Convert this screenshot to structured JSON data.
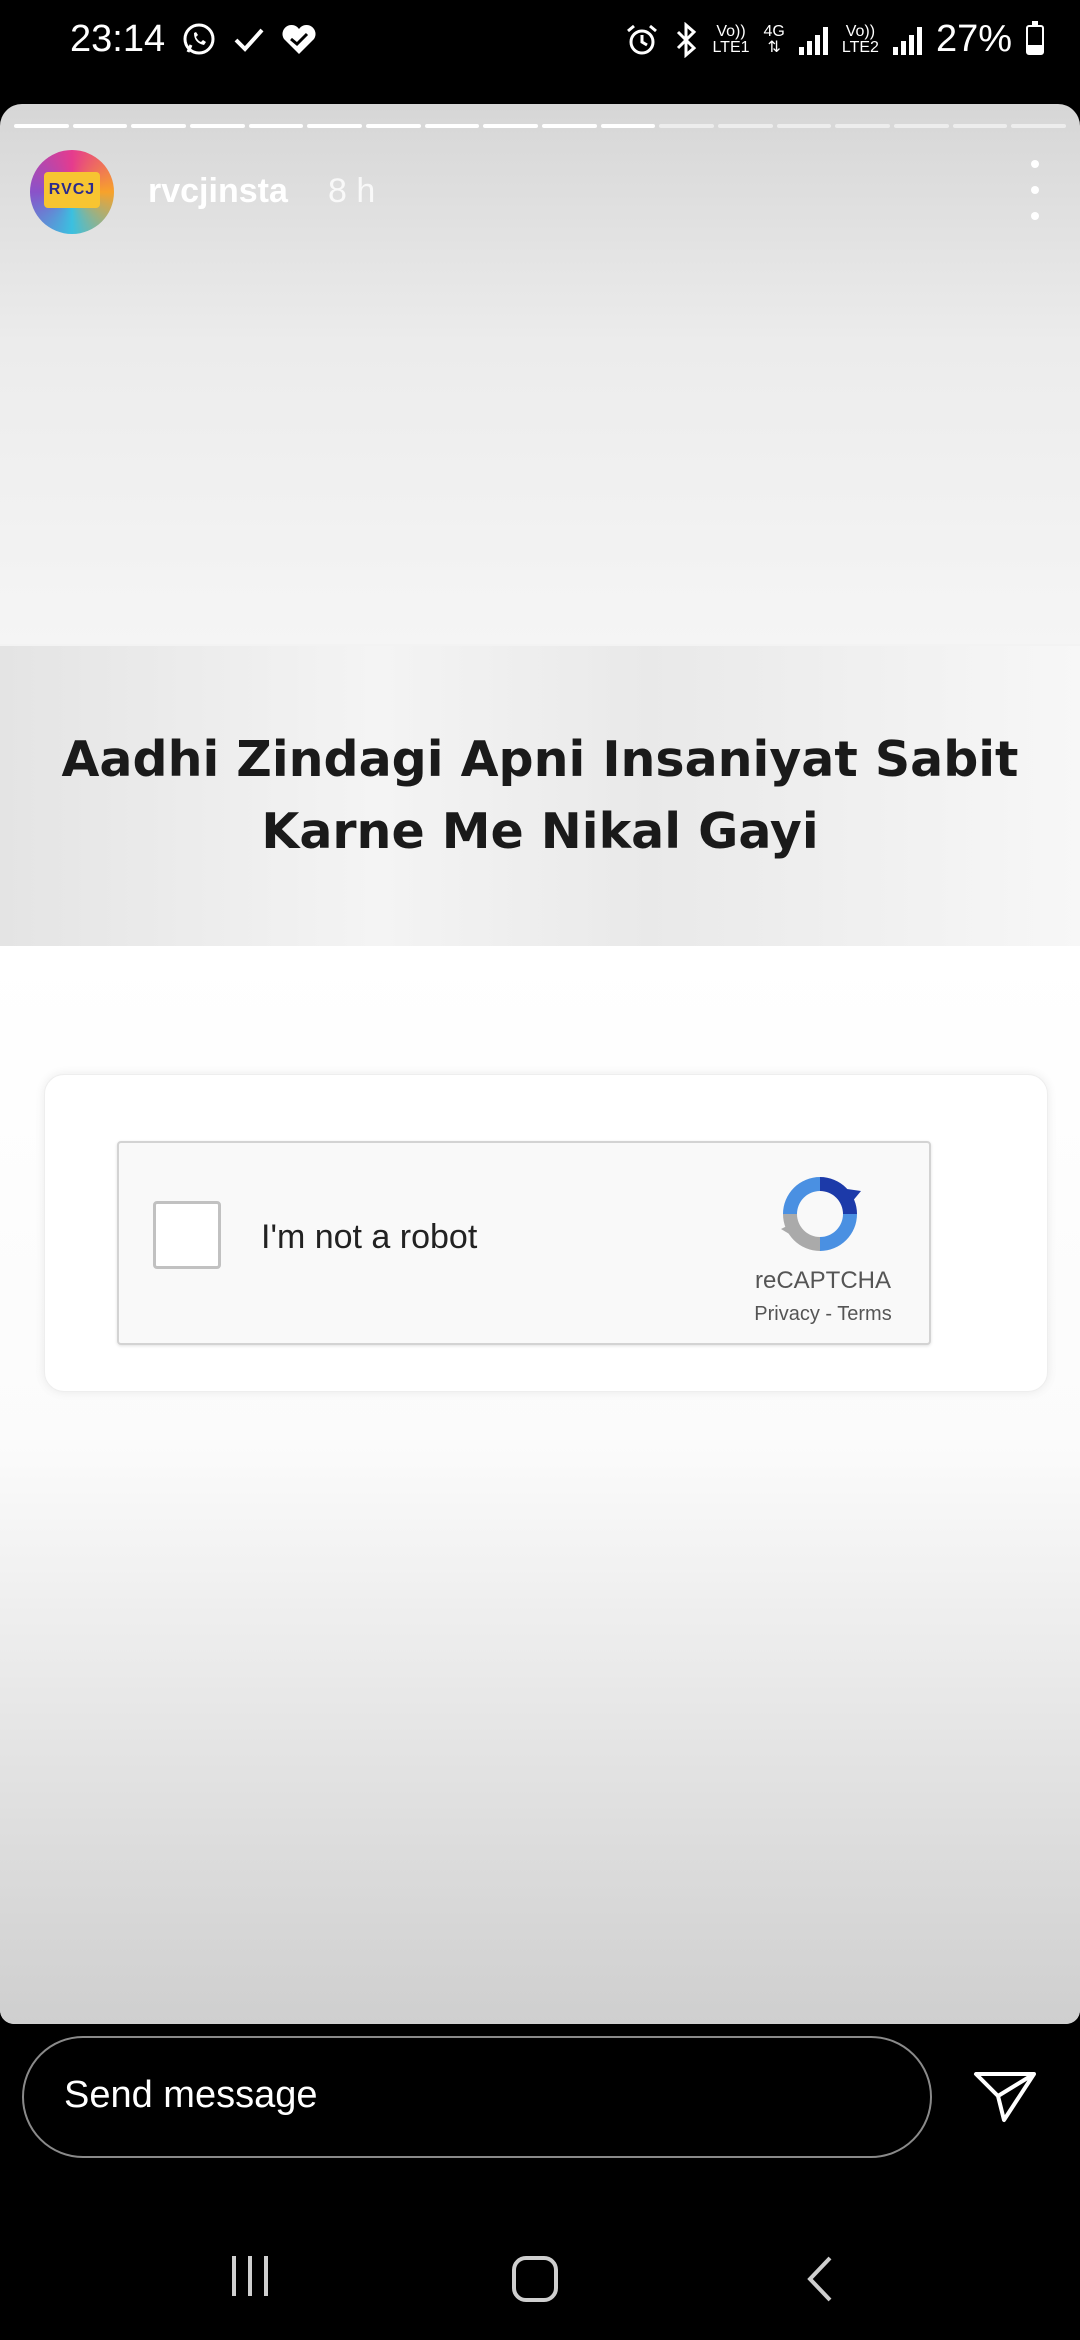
{
  "status_bar": {
    "time": "23:14",
    "left_icons": [
      "whatsapp-icon",
      "check-icon",
      "heart-check-icon"
    ],
    "right_icons": [
      "alarm-icon",
      "bluetooth-icon"
    ],
    "sim1_label_top": "Vo))",
    "sim1_label_bottom": "LTE1",
    "net_type": "4G",
    "sim2_label_top": "Vo))",
    "sim2_label_bottom": "LTE2",
    "battery_percent": "27%",
    "battery_level": 0.27
  },
  "story": {
    "progress_segments": 18,
    "progress_done": 11,
    "username": "rvcjinsta",
    "time_ago": "8 h",
    "avatar_text": "RVCJ",
    "meme": {
      "headline_line1": "Aadhi Zindagi Apni Insaniyat Sabit",
      "headline_line2": "Karne Me Nikal Gayi"
    },
    "captcha": {
      "checkbox_checked": false,
      "label": "I'm not a robot",
      "brand": "reCAPTCHA",
      "links": "Privacy - Terms"
    }
  },
  "message_bar": {
    "placeholder": "Send message"
  },
  "nav_bar": {
    "buttons": [
      "recent-apps",
      "home",
      "back"
    ]
  }
}
